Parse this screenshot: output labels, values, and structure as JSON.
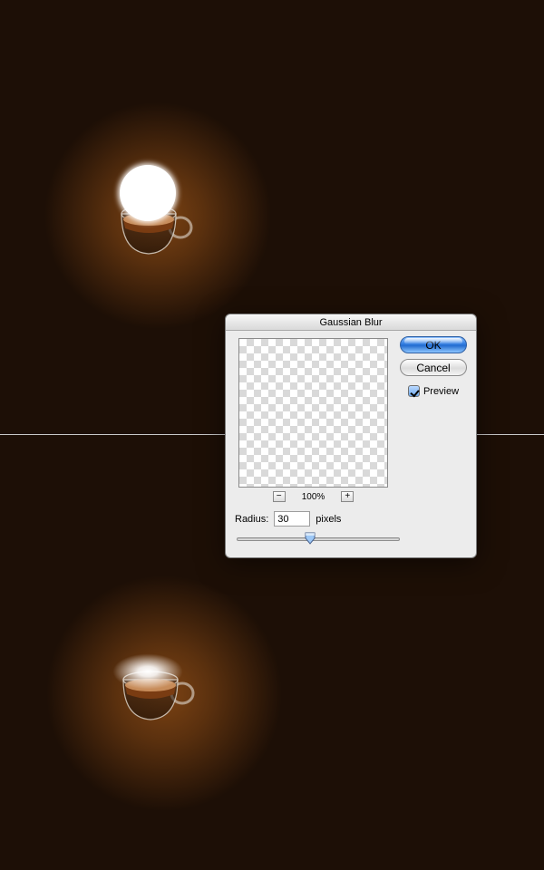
{
  "dialog": {
    "title": "Gaussian Blur",
    "ok_label": "OK",
    "cancel_label": "Cancel",
    "preview_label": "Preview",
    "preview_checked": true,
    "zoom_minus": "−",
    "zoom_level": "100%",
    "zoom_plus": "+",
    "radius_label": "Radius:",
    "radius_value": "30",
    "radius_unit": "pixels",
    "slider_percent": 45
  }
}
